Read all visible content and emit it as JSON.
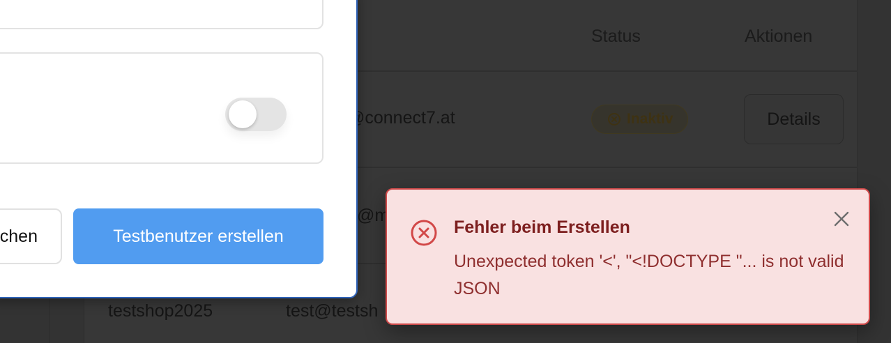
{
  "table": {
    "headers": {
      "status": "Status",
      "actions": "Aktionen"
    },
    "rows": [
      {
        "email_fragment": "@connect7.at",
        "status": "Inaktiv",
        "action": "Details"
      },
      {
        "email_fragment": "@ma"
      },
      {
        "username": "testshop2025",
        "email_fragment": "test@testsh"
      }
    ]
  },
  "modal": {
    "cancel_label": "Abbrechen",
    "submit_label": "Testbenutzer erstellen",
    "toggle_on": false
  },
  "toast": {
    "type": "error",
    "title": "Fehler beim Erstellen",
    "message": "Unexpected token '<', \"<!DOCTYPE \"... is not valid JSON",
    "close_icon": "close-icon",
    "status_icon": "error-circle-x-icon"
  },
  "colors": {
    "accent": "#519cf0",
    "error_border": "#cf4a4a",
    "error_bg": "#f9e1e1",
    "error_text": "#8f2f2f",
    "modal_border": "#2f63b8"
  }
}
